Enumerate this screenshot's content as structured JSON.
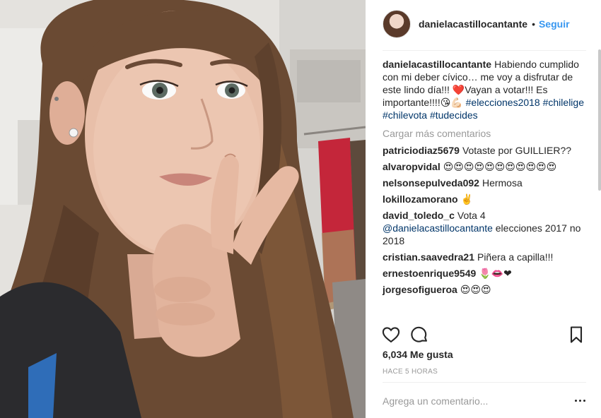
{
  "post": {
    "username": "danielacastillocantante",
    "separator": "•",
    "follow_label": "Seguir"
  },
  "caption": {
    "username": "danielacastillocantante",
    "text": "Habiendo cumplido con mi deber cívico… me voy a disfrutar de este lindo día!!! ❤️Vayan a votar!!! Es importante!!!!😘💪🏻",
    "hashtags": [
      "#elecciones2018",
      "#chilelige",
      "#chilevota",
      "#tudecides"
    ]
  },
  "load_more_label": "Cargar más comentarios",
  "comments": [
    {
      "username": "patriciodiaz5679",
      "text": "Votaste por GUILLIER??"
    },
    {
      "username": "alvaropvidal",
      "text": "😍😍😍😍😍😍😍😍😍😍😍"
    },
    {
      "username": "nelsonsepulveda092",
      "text": "Hermosa"
    },
    {
      "username": "lokillozamorano",
      "text": "✌️"
    },
    {
      "username": "david_toledo_c",
      "text": "Vota 4",
      "mention": "@danielacastillocantante",
      "text2": "elecciones 2017 no 2018"
    },
    {
      "username": "cristian.saavedra21",
      "text": "Piñera a capilla!!!"
    },
    {
      "username": "ernestoenrique9549",
      "text": "🌷👄❤"
    },
    {
      "username": "jorgesofigueroa",
      "text": "😍😍😍"
    }
  ],
  "actions": {
    "like_icon": "heart-outline-icon",
    "comment_icon": "comment-bubble-icon",
    "save_icon": "bookmark-icon"
  },
  "likes_label": "6,034 Me gusta",
  "time_label": "HACE 5 HORAS",
  "add_comment": {
    "placeholder": "Agrega un comentario..."
  },
  "more_icon": "ellipsis-icon",
  "colors": {
    "link": "#3897f0",
    "hashtag": "#003569",
    "muted": "#999999",
    "text": "#262626"
  }
}
